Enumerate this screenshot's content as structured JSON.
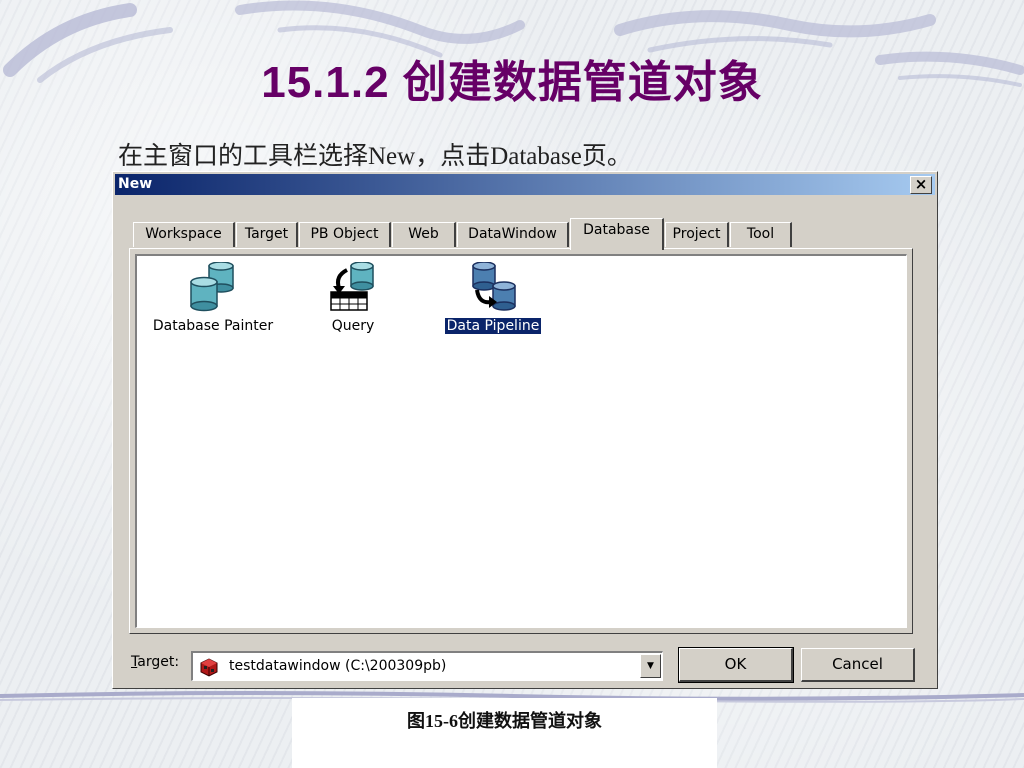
{
  "slide": {
    "title": "15.1.2 创建数据管道对象",
    "subtitle": "在主窗口的工具栏选择New，点击Database页。",
    "caption": "图15-6创建数据管道对象"
  },
  "dialog": {
    "title": "New",
    "close_label": "×",
    "tabs": [
      {
        "label": "Workspace",
        "active": false
      },
      {
        "label": "Target",
        "active": false
      },
      {
        "label": "PB Object",
        "active": false
      },
      {
        "label": "Web",
        "active": false
      },
      {
        "label": "DataWindow",
        "active": false
      },
      {
        "label": "Database",
        "active": true
      },
      {
        "label": "Project",
        "active": false
      },
      {
        "label": "Tool",
        "active": false
      }
    ],
    "items": [
      {
        "label": "Database Painter",
        "icon": "database-painter-icon",
        "selected": false
      },
      {
        "label": "Query",
        "icon": "query-icon",
        "selected": false
      },
      {
        "label": "Data Pipeline",
        "icon": "data-pipeline-icon",
        "selected": true
      }
    ],
    "target_label": "Target:",
    "target_value": "testdatawindow (C:\\200309pb)",
    "ok_label": "OK",
    "cancel_label": "Cancel"
  },
  "colors": {
    "title": "#660066",
    "titlebar_start": "#0a246a",
    "titlebar_end": "#a6caf0",
    "dialog_bg": "#d4d0c8",
    "selection": "#0a246a"
  }
}
